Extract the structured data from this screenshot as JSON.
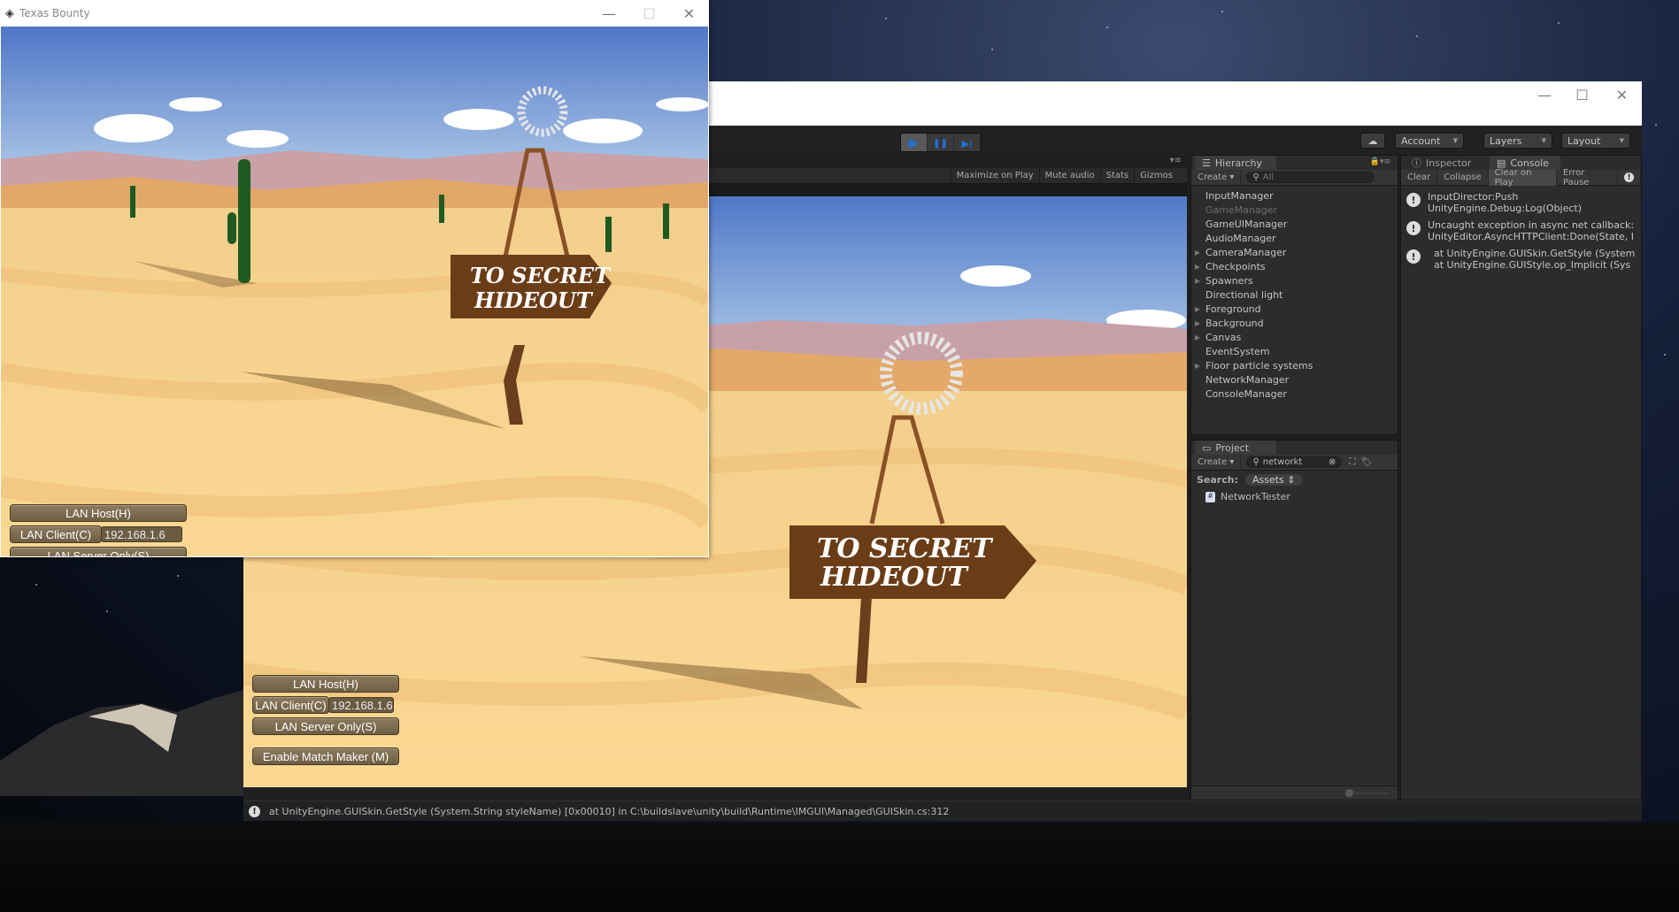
{
  "small_window": {
    "title": "Texas Bounty",
    "controls": {
      "minimize": "—",
      "maximize": "☐",
      "close": "✕"
    },
    "buttons": {
      "lan_host": "LAN Host(H)",
      "lan_client": "LAN Client(C)",
      "ip_value": "192.168.1.6",
      "lan_server": "LAN Server Only(S)"
    },
    "sign": {
      "line1": "TO SECRET",
      "line2": "HIDEOUT"
    }
  },
  "editor": {
    "controls": {
      "minimize": "—",
      "maximize": "☐",
      "close": "✕"
    },
    "toolbar": {
      "play": "▶",
      "pause": "❚❚",
      "step": "▶|",
      "cloud": "☁",
      "account": "Account",
      "layers": "Layers",
      "layout": "Layout"
    },
    "game_toolbar": {
      "maximize_on_play": "Maximize on Play",
      "mute_audio": "Mute audio",
      "stats": "Stats",
      "gizmos": "Gizmos"
    },
    "game": {
      "sign": {
        "line1": "TO SECRET",
        "line2": "HIDEOUT"
      },
      "buttons": {
        "lan_host": "LAN Host(H)",
        "lan_client": "LAN Client(C)",
        "ip_value": "192.168.1.6",
        "lan_server": "LAN Server Only(S)",
        "match_maker": "Enable Match Maker (M)"
      }
    },
    "hierarchy": {
      "tab": "Hierarchy",
      "create": "Create",
      "search_placeholder": "All",
      "items": [
        {
          "label": "InputManager",
          "expandable": false,
          "dim": false
        },
        {
          "label": "GameManager",
          "expandable": false,
          "dim": true
        },
        {
          "label": "GameUIManager",
          "expandable": false,
          "dim": false
        },
        {
          "label": "AudioManager",
          "expandable": false,
          "dim": false
        },
        {
          "label": "CameraManager",
          "expandable": true,
          "dim": false
        },
        {
          "label": "Checkpoints",
          "expandable": true,
          "dim": false
        },
        {
          "label": "Spawners",
          "expandable": true,
          "dim": false
        },
        {
          "label": "Directional light",
          "expandable": false,
          "dim": false
        },
        {
          "label": "Foreground",
          "expandable": true,
          "dim": false
        },
        {
          "label": "Background",
          "expandable": true,
          "dim": false
        },
        {
          "label": "Canvas",
          "expandable": true,
          "dim": false
        },
        {
          "label": "EventSystem",
          "expandable": false,
          "dim": false
        },
        {
          "label": "Floor particle systems",
          "expandable": true,
          "dim": false
        },
        {
          "label": "NetworkManager",
          "expandable": false,
          "dim": false
        },
        {
          "label": "ConsoleManager",
          "expandable": false,
          "dim": false
        }
      ]
    },
    "project": {
      "tab": "Project",
      "create": "Create",
      "search_value": "networkt",
      "search_label": "Search:",
      "scope": "Assets",
      "results": [
        "NetworkTester"
      ]
    },
    "inspector_tab": "Inspector",
    "console": {
      "tab": "Console",
      "buttons": {
        "clear": "Clear",
        "collapse": "Collapse",
        "clear_on_play": "Clear on Play",
        "error_pause": "Error Pause"
      },
      "entries": [
        {
          "line1": "InputDirector:Push",
          "line2": "UnityEngine.Debug:Log(Object)"
        },
        {
          "line1": "Uncaught exception in async net callback:",
          "line2": "UnityEditor.AsyncHTTPClient:Done(State, I"
        },
        {
          "line1": "  at UnityEngine.GUISkin.GetStyle (System",
          "line2": "  at UnityEngine.GUIStyle.op_Implicit (Sys"
        }
      ]
    },
    "status_bar": "at UnityEngine.GUISkin.GetStyle (System.String styleName) [0x00010] in C:\\buildslave\\unity\\build\\Runtime\\IMGUI\\Managed\\GUISkin.cs:312"
  }
}
